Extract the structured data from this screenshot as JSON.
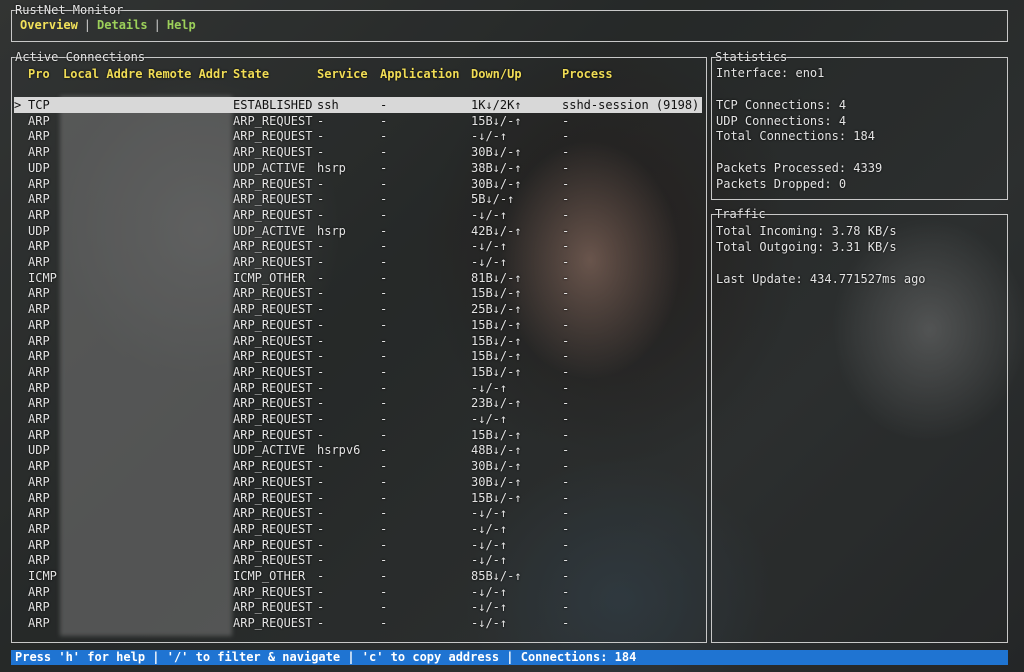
{
  "app_title": "RustNet Monitor",
  "tabs": [
    {
      "label": "Overview"
    },
    {
      "label": "Details"
    },
    {
      "label": "Help"
    }
  ],
  "tab_separator": "|",
  "connections_panel": {
    "title": "Active Connections",
    "columns": [
      "Pro",
      "Local Addre",
      "Remote Addr",
      "State",
      "Service",
      "Application",
      "Down/Up",
      "Process"
    ],
    "selected_marker": ">",
    "rows": [
      {
        "pro": "TCP",
        "local": "",
        "remote": "",
        "state": "ESTABLISHED",
        "service": "ssh",
        "app": "-",
        "downup": "1K↓/2K↑",
        "process": "sshd-session (9198)"
      },
      {
        "pro": "ARP",
        "local": "",
        "remote": "",
        "state": "ARP_REQUEST",
        "service": "-",
        "app": "-",
        "downup": "15B↓/-↑",
        "process": "-"
      },
      {
        "pro": "ARP",
        "local": "",
        "remote": "",
        "state": "ARP_REQUEST",
        "service": "-",
        "app": "-",
        "downup": "-↓/-↑",
        "process": "-"
      },
      {
        "pro": "ARP",
        "local": "",
        "remote": "",
        "state": "ARP_REQUEST",
        "service": "-",
        "app": "-",
        "downup": "30B↓/-↑",
        "process": "-"
      },
      {
        "pro": "UDP",
        "local": "",
        "remote": "",
        "state": "UDP_ACTIVE",
        "service": "hsrp",
        "app": "-",
        "downup": "38B↓/-↑",
        "process": "-"
      },
      {
        "pro": "ARP",
        "local": "",
        "remote": "",
        "state": "ARP_REQUEST",
        "service": "-",
        "app": "-",
        "downup": "30B↓/-↑",
        "process": "-"
      },
      {
        "pro": "ARP",
        "local": "",
        "remote": "",
        "state": "ARP_REQUEST",
        "service": "-",
        "app": "-",
        "downup": "5B↓/-↑",
        "process": "-"
      },
      {
        "pro": "ARP",
        "local": "",
        "remote": "",
        "state": "ARP_REQUEST",
        "service": "-",
        "app": "-",
        "downup": "-↓/-↑",
        "process": "-"
      },
      {
        "pro": "UDP",
        "local": "",
        "remote": "",
        "state": "UDP_ACTIVE",
        "service": "hsrp",
        "app": "-",
        "downup": "42B↓/-↑",
        "process": "-"
      },
      {
        "pro": "ARP",
        "local": "",
        "remote": "",
        "state": "ARP_REQUEST",
        "service": "-",
        "app": "-",
        "downup": "-↓/-↑",
        "process": "-"
      },
      {
        "pro": "ARP",
        "local": "",
        "remote": "",
        "state": "ARP_REQUEST",
        "service": "-",
        "app": "-",
        "downup": "-↓/-↑",
        "process": "-"
      },
      {
        "pro": "ICMP",
        "local": "",
        "remote": "",
        "state": "ICMP_OTHER",
        "service": "-",
        "app": "-",
        "downup": "81B↓/-↑",
        "process": "-"
      },
      {
        "pro": "ARP",
        "local": "",
        "remote": "",
        "state": "ARP_REQUEST",
        "service": "-",
        "app": "-",
        "downup": "15B↓/-↑",
        "process": "-"
      },
      {
        "pro": "ARP",
        "local": "",
        "remote": "",
        "state": "ARP_REQUEST",
        "service": "-",
        "app": "-",
        "downup": "25B↓/-↑",
        "process": "-"
      },
      {
        "pro": "ARP",
        "local": "",
        "remote": "",
        "state": "ARP_REQUEST",
        "service": "-",
        "app": "-",
        "downup": "15B↓/-↑",
        "process": "-"
      },
      {
        "pro": "ARP",
        "local": "",
        "remote": "",
        "state": "ARP_REQUEST",
        "service": "-",
        "app": "-",
        "downup": "15B↓/-↑",
        "process": "-"
      },
      {
        "pro": "ARP",
        "local": "",
        "remote": "",
        "state": "ARP_REQUEST",
        "service": "-",
        "app": "-",
        "downup": "15B↓/-↑",
        "process": "-"
      },
      {
        "pro": "ARP",
        "local": "",
        "remote": "",
        "state": "ARP_REQUEST",
        "service": "-",
        "app": "-",
        "downup": "15B↓/-↑",
        "process": "-"
      },
      {
        "pro": "ARP",
        "local": "",
        "remote": "",
        "state": "ARP_REQUEST",
        "service": "-",
        "app": "-",
        "downup": "-↓/-↑",
        "process": "-"
      },
      {
        "pro": "ARP",
        "local": "",
        "remote": "",
        "state": "ARP_REQUEST",
        "service": "-",
        "app": "-",
        "downup": "23B↓/-↑",
        "process": "-"
      },
      {
        "pro": "ARP",
        "local": "",
        "remote": "",
        "state": "ARP_REQUEST",
        "service": "-",
        "app": "-",
        "downup": "-↓/-↑",
        "process": "-"
      },
      {
        "pro": "ARP",
        "local": "",
        "remote": "",
        "state": "ARP_REQUEST",
        "service": "-",
        "app": "-",
        "downup": "15B↓/-↑",
        "process": "-"
      },
      {
        "pro": "UDP",
        "local": "",
        "remote": "",
        "state": "UDP_ACTIVE",
        "service": "hsrpv6",
        "app": "-",
        "downup": "48B↓/-↑",
        "process": "-"
      },
      {
        "pro": "ARP",
        "local": "",
        "remote": "",
        "state": "ARP_REQUEST",
        "service": "-",
        "app": "-",
        "downup": "30B↓/-↑",
        "process": "-"
      },
      {
        "pro": "ARP",
        "local": "",
        "remote": "",
        "state": "ARP_REQUEST",
        "service": "-",
        "app": "-",
        "downup": "30B↓/-↑",
        "process": "-"
      },
      {
        "pro": "ARP",
        "local": "",
        "remote": "",
        "state": "ARP_REQUEST",
        "service": "-",
        "app": "-",
        "downup": "15B↓/-↑",
        "process": "-"
      },
      {
        "pro": "ARP",
        "local": "",
        "remote": "",
        "state": "ARP_REQUEST",
        "service": "-",
        "app": "-",
        "downup": "-↓/-↑",
        "process": "-"
      },
      {
        "pro": "ARP",
        "local": "",
        "remote": "",
        "state": "ARP_REQUEST",
        "service": "-",
        "app": "-",
        "downup": "-↓/-↑",
        "process": "-"
      },
      {
        "pro": "ARP",
        "local": "",
        "remote": "",
        "state": "ARP_REQUEST",
        "service": "-",
        "app": "-",
        "downup": "-↓/-↑",
        "process": "-"
      },
      {
        "pro": "ARP",
        "local": "",
        "remote": "",
        "state": "ARP_REQUEST",
        "service": "-",
        "app": "-",
        "downup": "-↓/-↑",
        "process": "-"
      },
      {
        "pro": "ICMP",
        "local": "",
        "remote": "",
        "state": "ICMP_OTHER",
        "service": "-",
        "app": "-",
        "downup": "85B↓/-↑",
        "process": "-"
      },
      {
        "pro": "ARP",
        "local": "",
        "remote": "",
        "state": "ARP_REQUEST",
        "service": "-",
        "app": "-",
        "downup": "-↓/-↑",
        "process": "-"
      },
      {
        "pro": "ARP",
        "local": "",
        "remote": "",
        "state": "ARP_REQUEST",
        "service": "-",
        "app": "-",
        "downup": "-↓/-↑",
        "process": "-"
      },
      {
        "pro": "ARP",
        "local": "",
        "remote": "",
        "state": "ARP_REQUEST",
        "service": "-",
        "app": "-",
        "downup": "-↓/-↑",
        "process": "-"
      }
    ]
  },
  "statistics_panel": {
    "title": "Statistics",
    "interface": "Interface: eno1",
    "tcp": "TCP Connections: 4",
    "udp": "UDP Connections: 4",
    "total": "Total Connections: 184",
    "processed": "Packets Processed: 4339",
    "dropped": "Packets Dropped: 0"
  },
  "traffic_panel": {
    "title": "Traffic",
    "incoming": "Total Incoming: 3.78 KB/s",
    "outgoing": "Total Outgoing: 3.31 KB/s",
    "last_update": "Last Update: 434.771527ms ago"
  },
  "status_bar": {
    "text": "Press 'h' for help | '/' to filter & navigate | 'c' to copy address | Connections: 184"
  },
  "colors": {
    "header_yellow": "#f0dc55",
    "tab_green": "#9cd05a",
    "status_blue": "#1f74d2",
    "selection_bg": "#d8d8d8"
  }
}
